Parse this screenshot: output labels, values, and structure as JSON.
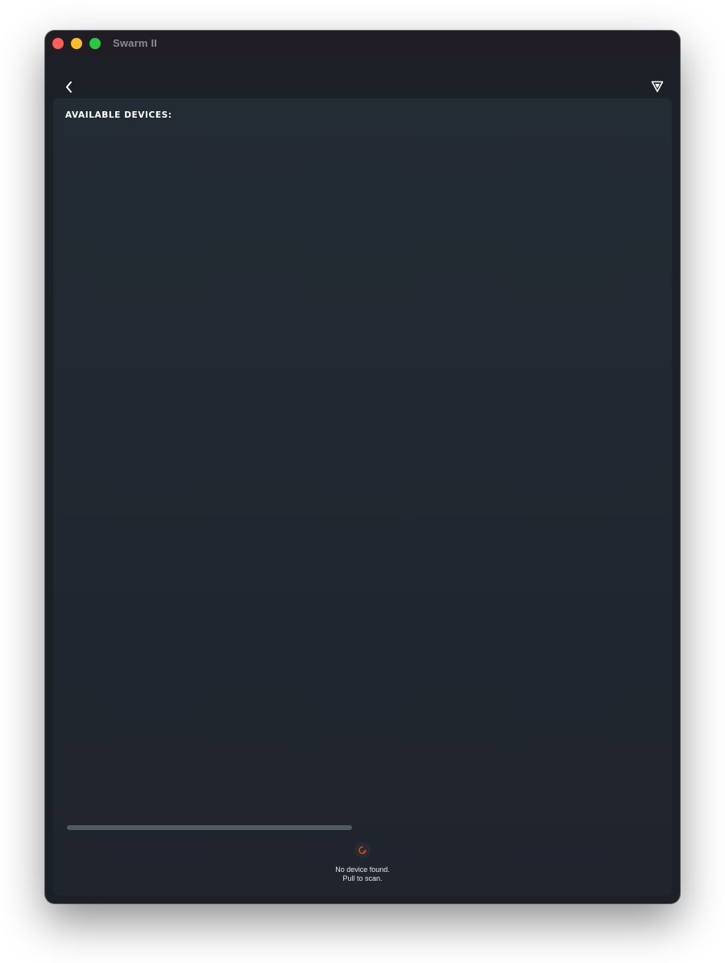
{
  "window": {
    "title": "Swarm II"
  },
  "toolbar": {
    "back_icon": "chevron-left-icon",
    "logo_icon": "brand-logo-icon"
  },
  "devices": {
    "section_label": "AVAILABLE DEVICES:",
    "scan_progress": 0.46,
    "empty_line1": "No device found.",
    "empty_line2": "Pull to scan."
  },
  "colors": {
    "window_bg": "#1c2027",
    "panel_bg": "#222831",
    "accent": "#c8553a",
    "progress": "#525a64"
  }
}
